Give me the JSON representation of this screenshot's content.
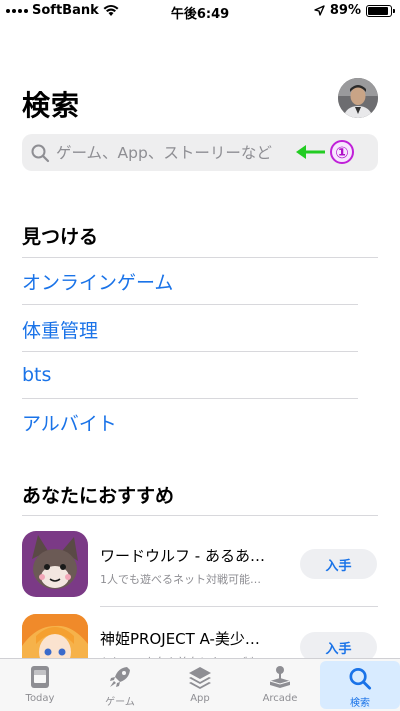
{
  "status_bar": {
    "carrier": "SoftBank",
    "time": "午後6:49",
    "battery": "89%",
    "battery_level": 0.89
  },
  "header": {
    "title": "検索"
  },
  "search": {
    "placeholder": "ゲーム、App、ストーリーなど",
    "annotation_number": "①",
    "annotation_color": "#c020d8",
    "arrow_color": "#22cc22"
  },
  "discover": {
    "title": "見つける",
    "items": [
      {
        "label": "オンラインゲーム"
      },
      {
        "label": "体重管理"
      },
      {
        "label": "bts"
      },
      {
        "label": "アルバイト"
      }
    ]
  },
  "recommendations": {
    "title": "あなたにおすすめ",
    "apps": [
      {
        "name": "ワードウルフ - あるあ…",
        "subtitle": "1人でも遊べるネット対戦可能…",
        "button": "入手"
      },
      {
        "name": "神姫PROJECT A-美少…",
        "subtitle": "かわいい少女や美女とターン制…",
        "button": "入手"
      }
    ]
  },
  "tab_bar": {
    "active_color": "#1a73e8",
    "tabs": [
      {
        "label": "Today",
        "icon": "today-icon"
      },
      {
        "label": "ゲーム",
        "icon": "rocket-icon"
      },
      {
        "label": "App",
        "icon": "layers-icon"
      },
      {
        "label": "Arcade",
        "icon": "joystick-icon"
      },
      {
        "label": "検索",
        "icon": "search-icon",
        "active": true
      }
    ]
  }
}
